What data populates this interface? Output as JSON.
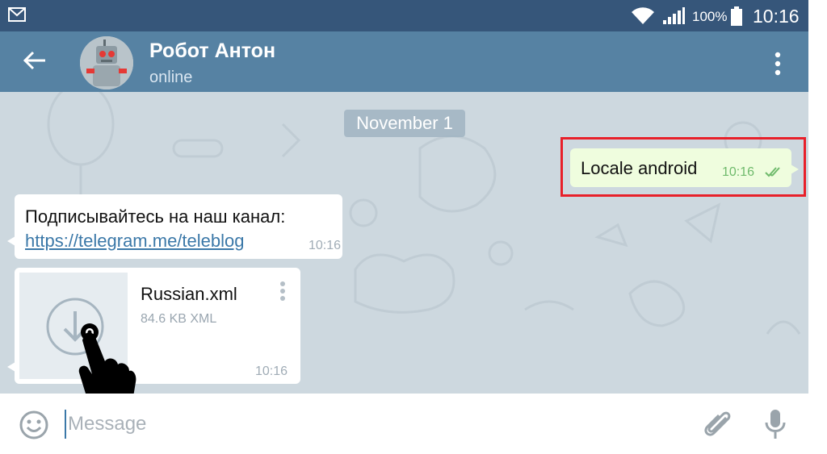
{
  "status_bar": {
    "battery_percent": "100%",
    "time": "10:16",
    "icons": [
      "mail-icon",
      "wifi-icon",
      "signal-icon",
      "battery-icon"
    ]
  },
  "header": {
    "contact_name": "Робот Антон",
    "presence": "online",
    "icons": [
      "back-arrow-icon",
      "avatar",
      "more-vert-icon"
    ]
  },
  "chat": {
    "date_separator": "November 1",
    "messages": [
      {
        "direction": "outgoing",
        "text": "Locale android",
        "time": "10:16",
        "status": "read"
      },
      {
        "direction": "incoming",
        "text": "Подписывайтесь на наш канал:",
        "link": "https://telegram.me/teleblog",
        "time": "10:16"
      },
      {
        "direction": "incoming",
        "type": "file",
        "file_name": "Russian.xml",
        "file_meta": "84.6 KB XML",
        "time": "10:16"
      }
    ]
  },
  "input_bar": {
    "placeholder": "Message",
    "icons": [
      "emoji-icon",
      "attach-icon",
      "mic-icon"
    ]
  },
  "colors": {
    "status_bar": "#36567a",
    "header": "#5682a3",
    "chat_background": "#cdd8df",
    "outgoing_bubble": "#effdde",
    "incoming_bubble": "#ffffff",
    "link": "#3b78a8",
    "highlight": "#e8202a",
    "read_checks": "#6fba6c"
  }
}
